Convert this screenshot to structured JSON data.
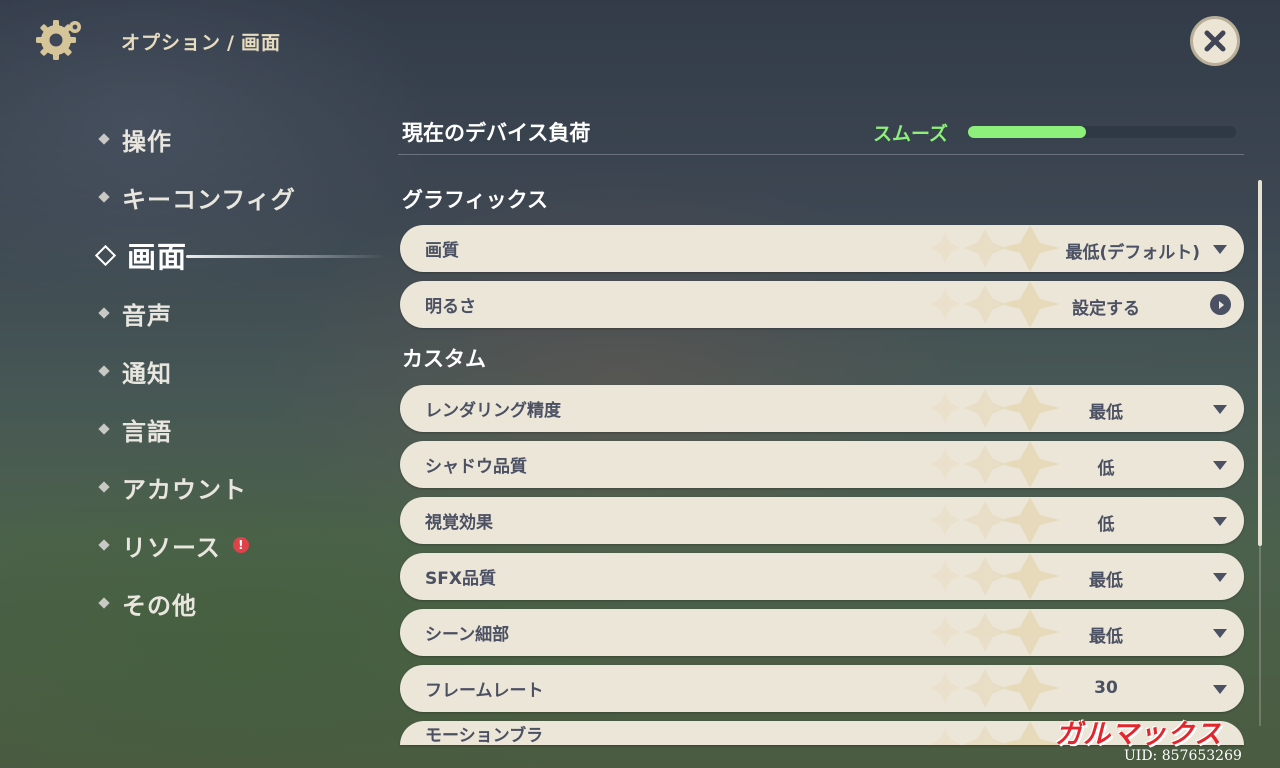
{
  "header": {
    "breadcrumb_parent": "オプション",
    "breadcrumb_sep": "/",
    "breadcrumb_current": "画面"
  },
  "sidebar": {
    "items": [
      {
        "label": "操作"
      },
      {
        "label": "キーコンフィグ"
      },
      {
        "label": "画面",
        "active": true
      },
      {
        "label": "音声"
      },
      {
        "label": "通知"
      },
      {
        "label": "言語"
      },
      {
        "label": "アカウント"
      },
      {
        "label": "リソース",
        "badge": "!"
      },
      {
        "label": "その他"
      }
    ]
  },
  "device_load": {
    "title": "現在のデバイス負荷",
    "status": "スムーズ",
    "level_percent": 44,
    "status_color": "#8df07a"
  },
  "sections": {
    "graphics": "グラフィックス",
    "custom": "カスタム"
  },
  "graphics_rows": [
    {
      "name": "画質",
      "value": "最低(デフォルト)",
      "control": "dropdown"
    },
    {
      "name": "明るさ",
      "value": "設定する",
      "control": "arrow-button"
    }
  ],
  "custom_rows": [
    {
      "name": "レンダリング精度",
      "value": "最低",
      "control": "dropdown"
    },
    {
      "name": "シャドウ品質",
      "value": "低",
      "control": "dropdown"
    },
    {
      "name": "視覚効果",
      "value": "低",
      "control": "dropdown"
    },
    {
      "name": "SFX品質",
      "value": "最低",
      "control": "dropdown"
    },
    {
      "name": "シーン細部",
      "value": "最低",
      "control": "dropdown"
    },
    {
      "name": "フレームレート",
      "value": "30",
      "control": "dropdown"
    },
    {
      "name": "モーションブラ",
      "value": "",
      "control": "partial"
    }
  ],
  "footer": {
    "watermark": "ガルマックス",
    "uid": "UID: 857653269"
  },
  "colors": {
    "row_bg": "#ece6d9",
    "row_text": "#4b5162",
    "accent_green": "#8df07a",
    "badge_red": "#e0424a"
  }
}
